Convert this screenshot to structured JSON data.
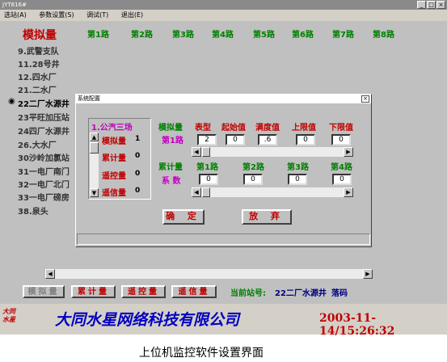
{
  "window": {
    "title": "JYT816#",
    "btn_min": "_",
    "btn_max": "□",
    "btn_close": "×"
  },
  "menu": [
    "选站(A)",
    "参数设置(S)",
    "调试(T)",
    "退出(E)"
  ],
  "main": {
    "header_label": "模拟量",
    "roads": [
      "第1路",
      "第2路",
      "第3路",
      "第4路",
      "第5路",
      "第6路",
      "第7路",
      "第8路"
    ],
    "stations": [
      "9.武警支队",
      "11.28号井",
      "12.四水厂",
      "21.二水厂",
      "22二厂水源井",
      "23平旺加压站",
      "24四厂水源井",
      "26.大水厂",
      "30沙岭加氯站",
      "31一电厂南门",
      "32一电厂北门",
      "33一电厂磅房",
      "38.泉头"
    ],
    "selected_station_marker": "◉"
  },
  "dialog": {
    "title": "系统配置",
    "close": "×",
    "left_list": {
      "title": "1.公汽三场",
      "items": [
        {
          "label": "模拟量",
          "value": "1"
        },
        {
          "label": "累计量",
          "value": "0"
        },
        {
          "label": "遥控量",
          "value": "0"
        },
        {
          "label": "遥信量",
          "value": "0"
        }
      ]
    },
    "analog": {
      "label": "模拟量",
      "road": "第1路",
      "headers": [
        "表型",
        "起始值",
        "满度值",
        "上限值",
        "下限值"
      ],
      "values": [
        "2",
        "0",
        ".6",
        "0",
        "0"
      ]
    },
    "cumulative": {
      "label": "累计量",
      "sub": "系  数",
      "headers": [
        "第1路",
        "第2路",
        "第3路",
        "第4路"
      ],
      "values": [
        "0",
        "0",
        "0",
        "0"
      ]
    },
    "ok": "确  定",
    "cancel": "放  弃",
    "scroll_up": "▲",
    "scroll_down": "▼",
    "scroll_left": "◀",
    "scroll_right": "▶"
  },
  "tabs": [
    {
      "label": "模拟量",
      "active": true
    },
    {
      "label": "累计量",
      "active": false
    },
    {
      "label": "遥控量",
      "active": false
    },
    {
      "label": "遥信量",
      "active": false
    }
  ],
  "status": {
    "label": "当前站号:",
    "station": "22二厂水源井",
    "state": "落码"
  },
  "footer": {
    "logo": "大同\n水星",
    "company": "大同水星网络科技有限公司",
    "datetime": "2003-11-14/15:26:32"
  },
  "caption": "上位机监控软件设置界面"
}
